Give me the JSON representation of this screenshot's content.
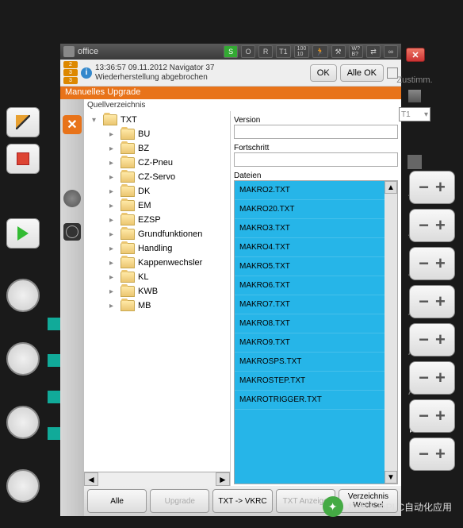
{
  "title_bar": {
    "robot_name": "office",
    "s": "S",
    "r": "R",
    "t1": "T1",
    "speed_top": "100",
    "speed_bot": "10",
    "w": "W?",
    "b": "B?",
    "inf": "∞",
    "o": "O"
  },
  "info": {
    "badge1": "2",
    "badge2": "3",
    "badge3": "3",
    "timestamp": "13:36:57 09.11.2012 Navigator 37",
    "message": "Wiederherstellung abgebrochen",
    "ok": "OK",
    "all_ok": "Alle OK"
  },
  "banner": "Manuelles Upgrade",
  "source_label": "Quellverzeichnis",
  "tree": {
    "root": "TXT",
    "items": [
      "BU",
      "BZ",
      "CZ-Pneu",
      "CZ-Servo",
      "DK",
      "EM",
      "EZSP",
      "Grundfunktionen",
      "Handling",
      "Kappenwechsler",
      "KL",
      "KWB",
      "MB"
    ]
  },
  "right": {
    "version": "Version",
    "progress": "Fortschritt",
    "files": "Dateien",
    "file_list": [
      "MAKRO2.TXT",
      "MAKRO20.TXT",
      "MAKRO3.TXT",
      "MAKRO4.TXT",
      "MAKRO5.TXT",
      "MAKRO6.TXT",
      "MAKRO7.TXT",
      "MAKRO8.TXT",
      "MAKRO9.TXT",
      "MAKROSPS.TXT",
      "MAKROSTEP.TXT",
      "MAKROTRIGGER.TXT"
    ]
  },
  "bottom": {
    "all": "Alle",
    "upgrade": "Upgrade",
    "txt_vkrc": "TXT -> VKRC",
    "txt_anzeige": "TXT Anzeige",
    "verz_wechsel": "Verzeichnis Wechsel"
  },
  "right_strip": {
    "zustimm": "Zustimm.",
    "mode": "T1",
    "a1": "A1",
    "a2": "A2",
    "a3": "A3",
    "a4": "A4",
    "a5": "A5",
    "a6": "A6"
  },
  "watermark": "机器人及PLC自动化应用"
}
